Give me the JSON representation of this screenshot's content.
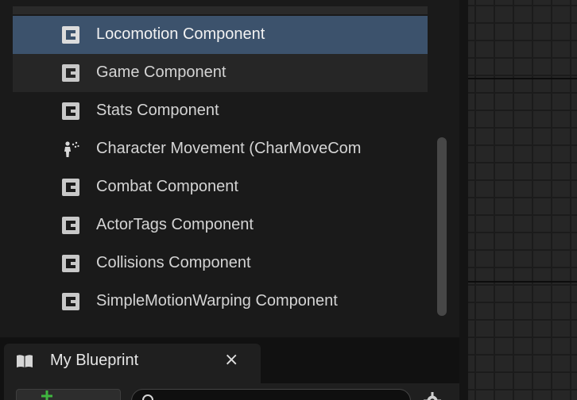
{
  "components_panel": {
    "items": [
      {
        "label": "Locomotion Component",
        "icon": "component-class-icon",
        "state": "selected"
      },
      {
        "label": "Game Component",
        "icon": "component-class-icon",
        "state": "hovered"
      },
      {
        "label": "Stats Component",
        "icon": "component-class-icon",
        "state": "normal"
      },
      {
        "label": "Character Movement (CharMoveCom",
        "icon": "character-movement-icon",
        "state": "normal"
      },
      {
        "label": "Combat Component",
        "icon": "component-class-icon",
        "state": "normal"
      },
      {
        "label": "ActorTags Component",
        "icon": "component-class-icon",
        "state": "normal"
      },
      {
        "label": "Collisions Component",
        "icon": "component-class-icon",
        "state": "normal"
      },
      {
        "label": "SimpleMotionWarping Component",
        "icon": "component-class-icon",
        "state": "normal"
      }
    ]
  },
  "bottom_tab": {
    "label": "My Blueprint",
    "icon": "book-icon",
    "close_glyph": "×"
  },
  "toolbar": {
    "add_icon": "plus-icon",
    "search_icon": "search-icon",
    "settings_icon": "gear-icon"
  },
  "colors": {
    "selected_row": "#3c526c",
    "panel_bg": "#1a1a1a",
    "graph_bg": "#262626"
  }
}
